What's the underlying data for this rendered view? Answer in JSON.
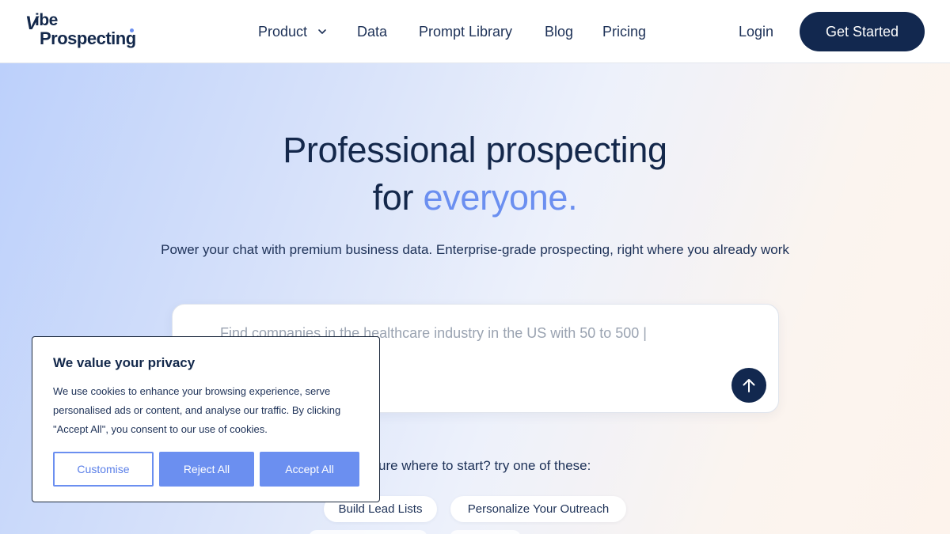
{
  "header": {
    "logo_line1": "ibe",
    "logo_slash": "V",
    "logo_line2": "Prospecting",
    "nav": {
      "product": "Product",
      "data": "Data",
      "prompt_library": "Prompt Library",
      "blog": "Blog",
      "pricing": "Pricing"
    },
    "login": "Login",
    "cta": "Get Started"
  },
  "hero": {
    "title_line1": "Professional prospecting",
    "title_line2_prefix": "for",
    "title_line2_accent": "everyone.",
    "subtitle": "Power your chat with premium business data. Enterprise-grade prospecting, right where you already work",
    "search_placeholder": "Find companies in the healthcare industry in the US with 50 to 500 |",
    "try_text": "ure where to start? try one of these:",
    "chips": [
      "Build Lead Lists",
      "Personalize Your Outreach"
    ]
  },
  "cookie": {
    "title": "We value your privacy",
    "text": "We use cookies to enhance your browsing experience, serve personalised ads or content, and analyse our traffic. By clicking \"Accept All\", you consent to our use of cookies.",
    "customise": "Customise",
    "reject": "Reject All",
    "accept": "Accept All"
  },
  "colors": {
    "navy": "#12284f",
    "accent": "#6b8ff0"
  },
  "icons": {
    "chevron": "chevron-down-icon",
    "send": "arrow-up-icon"
  }
}
